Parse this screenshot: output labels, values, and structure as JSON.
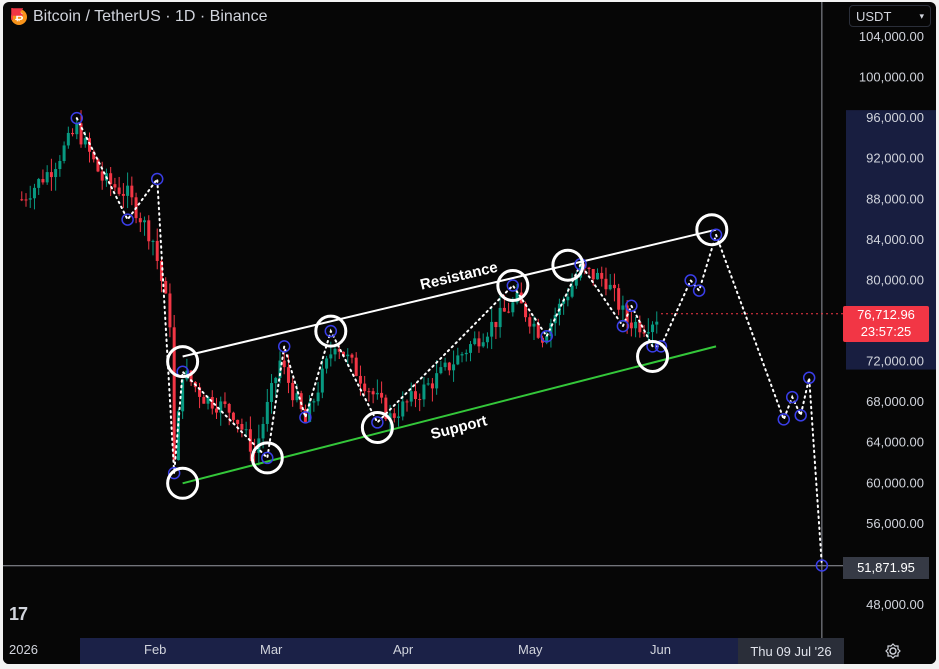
{
  "header": {
    "logo_text": "₿",
    "title": "Bitcoin / TetherUS · 1D · Binance",
    "flag_color": "#f23645"
  },
  "currency_selector": {
    "value": "USDT"
  },
  "price_scale": {
    "ticks": [
      "104,000.00",
      "100,000.00",
      "96,000.00",
      "92,000.00",
      "88,000.00",
      "84,000.00",
      "80,000.00",
      "76,000.00",
      "72,000.00",
      "68,000.00",
      "64,000.00",
      "60,000.00",
      "56,000.00",
      "52,000.00",
      "48,000.00"
    ],
    "current_price": "76,712.96",
    "countdown": "23:57:25",
    "crosshair_price": "51,871.95",
    "current_price_color": "#f23645"
  },
  "time_axis": {
    "labels": [
      "2026",
      "Feb",
      "Mar",
      "Apr",
      "May",
      "Jun"
    ],
    "crosshair_date": "Thu 09 Jul '26"
  },
  "annotations": {
    "resistance": "Resistance",
    "support": "Support"
  },
  "colors": {
    "up": "#089981",
    "down": "#f23645",
    "resistance_line": "#ffffff",
    "support_line": "#34c73a",
    "marker": "#3a3ee8",
    "background": "#060606"
  },
  "chart_data": {
    "type": "candlestick",
    "title": "Bitcoin / TetherUS · 1D · Binance",
    "ylim": [
      46000,
      106000
    ],
    "price_path": [
      [
        "2026-01-01",
        88000
      ],
      [
        "2026-01-08",
        91000
      ],
      [
        "2026-01-14",
        95000
      ],
      [
        "2026-01-20",
        90000
      ],
      [
        "2026-01-26",
        88500
      ],
      [
        "2026-02-01",
        84000
      ],
      [
        "2026-02-05",
        76000
      ],
      [
        "2026-02-06",
        62000
      ],
      [
        "2026-02-08",
        71000
      ],
      [
        "2026-02-13",
        68500
      ],
      [
        "2026-02-20",
        67000
      ],
      [
        "2026-02-25",
        63000
      ],
      [
        "2026-03-03",
        72000
      ],
      [
        "2026-03-09",
        66000
      ],
      [
        "2026-03-16",
        74000
      ],
      [
        "2026-03-22",
        70500
      ],
      [
        "2026-03-29",
        66500
      ],
      [
        "2026-04-08",
        70000
      ],
      [
        "2026-04-18",
        74000
      ],
      [
        "2026-04-28",
        78000
      ],
      [
        "2026-05-04",
        74500
      ],
      [
        "2026-05-13",
        81000
      ],
      [
        "2026-05-19",
        80000
      ],
      [
        "2026-05-24",
        76000
      ],
      [
        "2026-05-28",
        75500
      ],
      [
        "2026-06-01",
        76700
      ]
    ],
    "projection": [
      [
        "2026-06-01",
        73500
      ],
      [
        "2026-06-08",
        80000
      ],
      [
        "2026-06-10",
        79000
      ],
      [
        "2026-06-14",
        84500
      ],
      [
        "2026-06-30",
        66300
      ],
      [
        "2026-07-02",
        68500
      ],
      [
        "2026-07-04",
        66700
      ],
      [
        "2026-07-06",
        70400
      ],
      [
        "2026-07-09",
        51900
      ]
    ],
    "resistance_line": [
      [
        "2026-02-08",
        72500
      ],
      [
        "2026-06-14",
        85000
      ]
    ],
    "support_line": [
      [
        "2026-02-08",
        60000
      ],
      [
        "2026-06-14",
        73500
      ]
    ],
    "touch_points": [
      [
        "2026-02-08",
        72000
      ],
      [
        "2026-02-08",
        60000
      ],
      [
        "2026-02-28",
        62500
      ],
      [
        "2026-03-15",
        75000
      ],
      [
        "2026-03-26",
        65500
      ],
      [
        "2026-04-27",
        79500
      ],
      [
        "2026-05-10",
        81500
      ],
      [
        "2026-05-30",
        72500
      ],
      [
        "2026-06-13",
        85000
      ]
    ],
    "current_price": 76712.96,
    "crosshair": {
      "date": "Thu 09 Jul '26",
      "price": 51871.95
    }
  }
}
